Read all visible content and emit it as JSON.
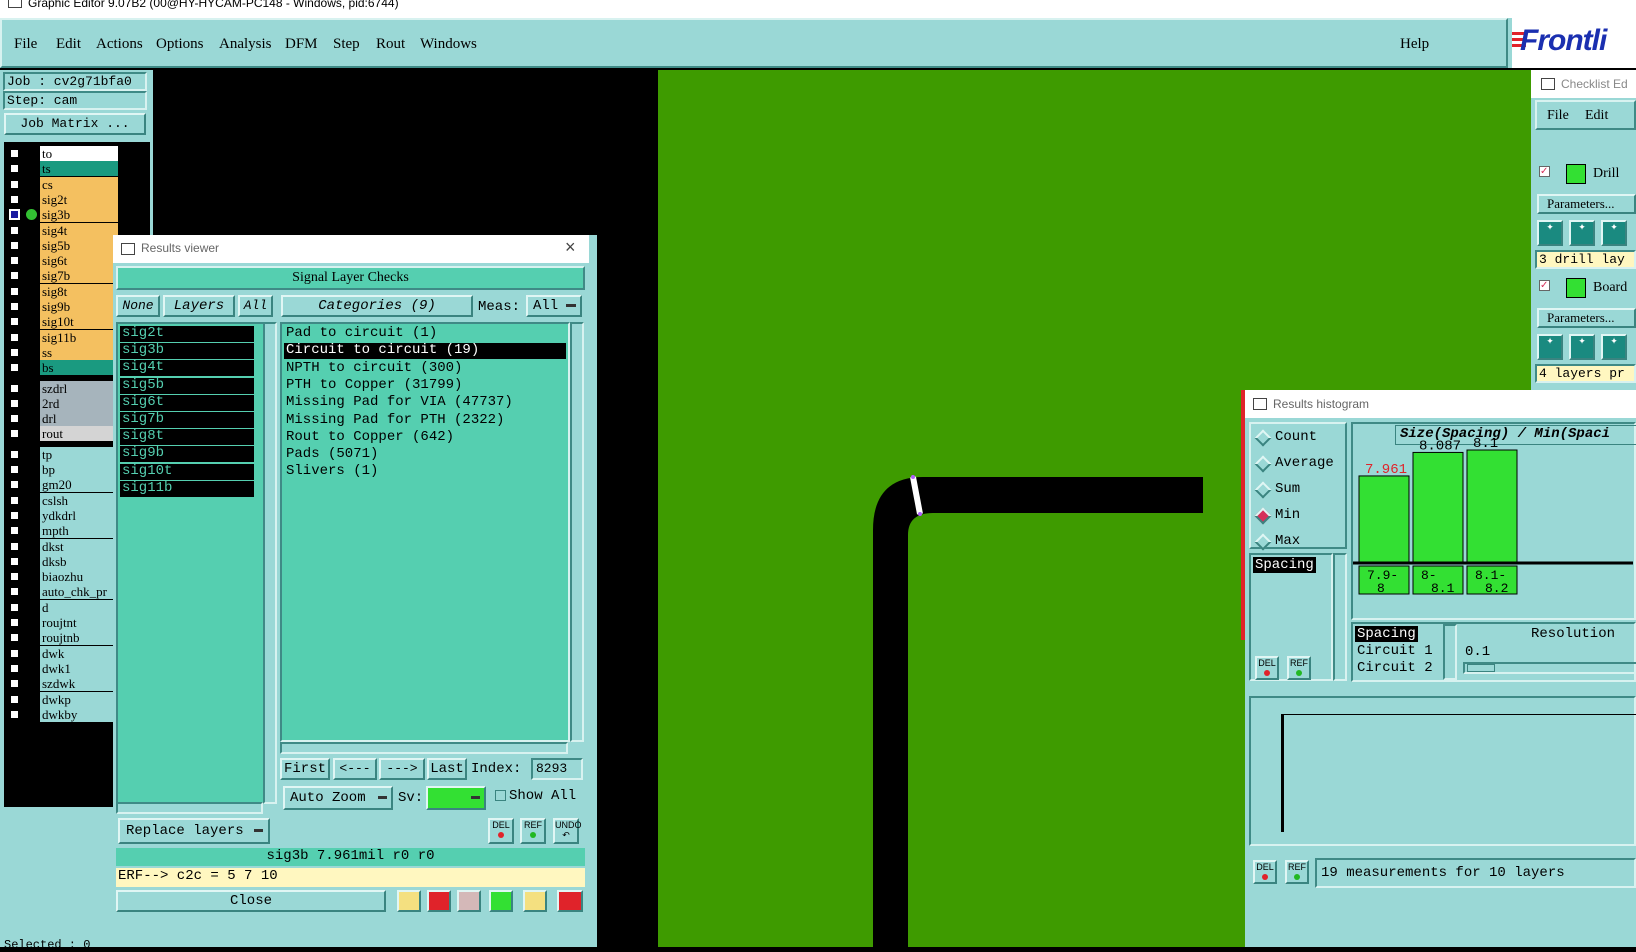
{
  "window_title": "Graphic Editor 9.07B2 (00@HY-HYCAM-PC148 - Windows, pid:6744)",
  "menu": [
    "File",
    "Edit",
    "Actions",
    "Options",
    "Analysis",
    "DFM",
    "Step",
    "Rout",
    "Windows"
  ],
  "help_label": "Help",
  "logo_text": "Frontli",
  "job": {
    "job_label": "Job : cv2g71bfa0",
    "step_label": "Step: cam",
    "matrix_button": "Job Matrix ..."
  },
  "layers": [
    {
      "name": "to",
      "color": "#ffffff"
    },
    {
      "name": "ts",
      "color": "#1a9a80"
    },
    {
      "name": "cs",
      "color": "#f4c060"
    },
    {
      "name": "sig2t",
      "color": "#f4c060"
    },
    {
      "name": "sig3b",
      "color": "#f4c060"
    },
    {
      "name": "sig4t",
      "color": "#f4c060"
    },
    {
      "name": "sig5b",
      "color": "#f4c060"
    },
    {
      "name": "sig6t",
      "color": "#f4c060"
    },
    {
      "name": "sig7b",
      "color": "#f4c060"
    },
    {
      "name": "sig8t",
      "color": "#f4c060"
    },
    {
      "name": "sig9b",
      "color": "#f4c060"
    },
    {
      "name": "sig10t",
      "color": "#f4c060"
    },
    {
      "name": "sig11b",
      "color": "#f4c060"
    },
    {
      "name": "ss",
      "color": "#f4c060"
    },
    {
      "name": "bs",
      "color": "#1a9a80"
    }
  ],
  "drill_layers": [
    {
      "name": "szdrl",
      "color": "#a6b4bc"
    },
    {
      "name": "2rd",
      "color": "#a6b4bc"
    },
    {
      "name": "drl",
      "color": "#a6b4bc"
    },
    {
      "name": "rout",
      "color": "#d4d4d4"
    }
  ],
  "misc_layers": [
    "tp",
    "bp",
    "gm20",
    "cslsh",
    "ydkdrl",
    "mpth",
    "dkst",
    "dksb",
    "biaozhu",
    "auto_chk_pr",
    "d",
    "roujtnt",
    "roujtnb",
    "dwk",
    "dwk1",
    "szdwk",
    "dwkp",
    "dwkby"
  ],
  "selected_label": "Selected : 0",
  "results_viewer": {
    "title": "Results viewer",
    "header": "Signal Layer Checks",
    "none_btn": "None",
    "layers_btn": "Layers",
    "all_btn": "All",
    "categories_btn": "Categories (9)",
    "meas_label": "Meas:",
    "meas_value": "All",
    "layer_list": [
      "sig2t",
      "sig3b",
      "sig4t",
      "sig5b",
      "sig6t",
      "sig7b",
      "sig8t",
      "sig9b",
      "sig10t",
      "sig11b"
    ],
    "categories": [
      "Pad to circuit (1)",
      "Circuit to circuit (19)",
      "NPTH to circuit (300)",
      "PTH to Copper (31799)",
      "Missing Pad for VIA (47737)",
      "Missing Pad for PTH (2322)",
      "Rout to Copper (642)",
      "Pads (5071)",
      "Slivers (1)"
    ],
    "selected_category": 1,
    "first_btn": "First",
    "prev_btn": "<---",
    "next_btn": "--->",
    "last_btn": "Last",
    "index_label": "Index:",
    "index_value": "8293",
    "zoom_value": "Auto Zoom",
    "sv_label": "Sv:",
    "show_all_label": "Show All",
    "replace_layers": "Replace layers",
    "status": "sig3b 7.961mil  r0  r0",
    "erf_line": "ERF--> c2c = 5 7 10",
    "close_btn": "Close",
    "del_label": "DEL",
    "ref_label": "REF",
    "undo_label": "UNDO"
  },
  "checklist": {
    "title": "Checklist Ed",
    "file": "File",
    "edit": "Edit",
    "drill_label": "Drill",
    "params1": "Parameters...",
    "drill_info": "3 drill lay",
    "board_label": "Board",
    "params2": "Parameters...",
    "board_info": "4 layers pr"
  },
  "histogram": {
    "title": "Results histogram",
    "modes": [
      "Count",
      "Average",
      "Sum",
      "Min",
      "Max"
    ],
    "selected_mode": "Min",
    "spacing_item": "Spacing",
    "chart_title": "Size(Spacing) / Min(Spaci",
    "resolution_label": "Resolution",
    "resolution_value": "0.1",
    "attr_list": [
      "Spacing",
      "Circuit 1",
      "Circuit 2"
    ],
    "summary": "19 measurements for 10 layers",
    "chart_data": {
      "type": "bar",
      "categories": [
        "7.9-8",
        "8-8.1",
        "8.1-8.2"
      ],
      "category_labels": [
        [
          "7.9-",
          "8"
        ],
        [
          "8-",
          "8.1"
        ],
        [
          "8.1-",
          "8.2"
        ]
      ],
      "values": [
        7.961,
        8.087,
        8.1
      ],
      "value_labels": [
        "7.961",
        "8.087",
        "8.1"
      ],
      "highlight_color": "#e0232a",
      "bar_color": "#33e033"
    }
  },
  "colors": {
    "board_green": "#3e9b00",
    "panel_teal": "#9ad8d6",
    "list_mint": "#55cfb0",
    "highlight_red": "#e0232a"
  }
}
